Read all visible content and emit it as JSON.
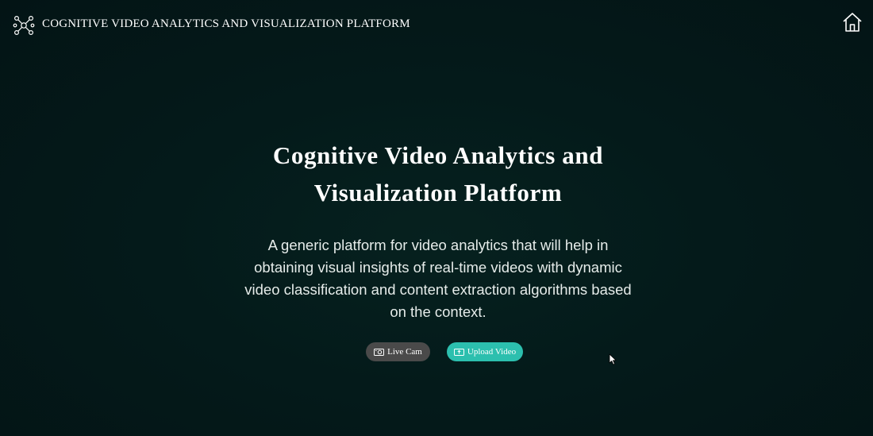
{
  "header": {
    "app_title": "COGNITIVE VIDEO ANALYTICS AND VISUALIZATION PLATFORM",
    "logo_icon": "network-nodes-icon",
    "home_icon": "home-icon"
  },
  "hero": {
    "title": "Cognitive Video Analytics and Visualization Platform",
    "description": "A generic platform for video analytics that will help in obtaining visual insights of real-time videos with dynamic video classification and content extraction algorithms based on the context."
  },
  "actions": {
    "live_cam_label": "Live Cam",
    "live_cam_icon": "camera-icon",
    "upload_label": "Upload Video",
    "upload_icon": "upload-video-icon"
  },
  "colors": {
    "background": "#041a1a",
    "live_cam_button": "#4a4a4a",
    "upload_button": "#2cbfae",
    "text": "#ffffff"
  }
}
